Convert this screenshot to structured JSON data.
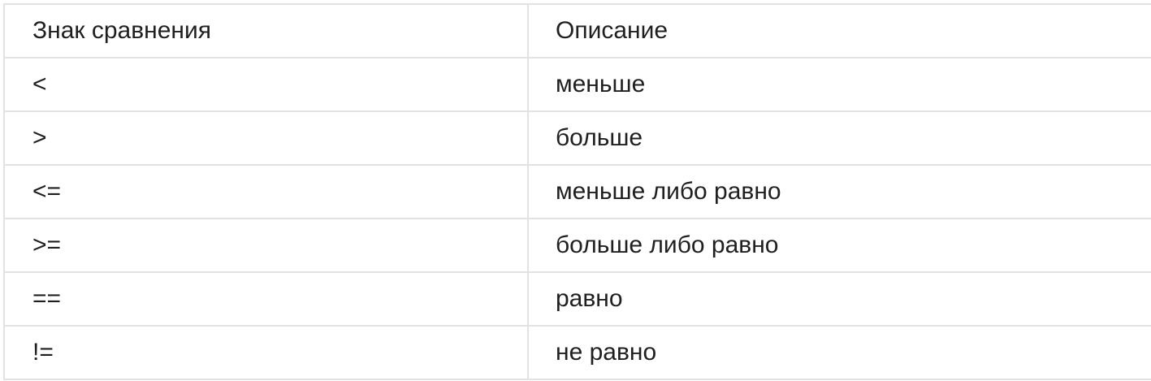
{
  "table": {
    "headers": [
      "Знак сравнения",
      "Описание"
    ],
    "rows": [
      [
        "<",
        "меньше"
      ],
      [
        ">",
        "больше"
      ],
      [
        "<=",
        "меньше либо равно"
      ],
      [
        ">=",
        "больше либо равно"
      ],
      [
        "==",
        "равно"
      ],
      [
        "!=",
        "не равно"
      ]
    ]
  }
}
